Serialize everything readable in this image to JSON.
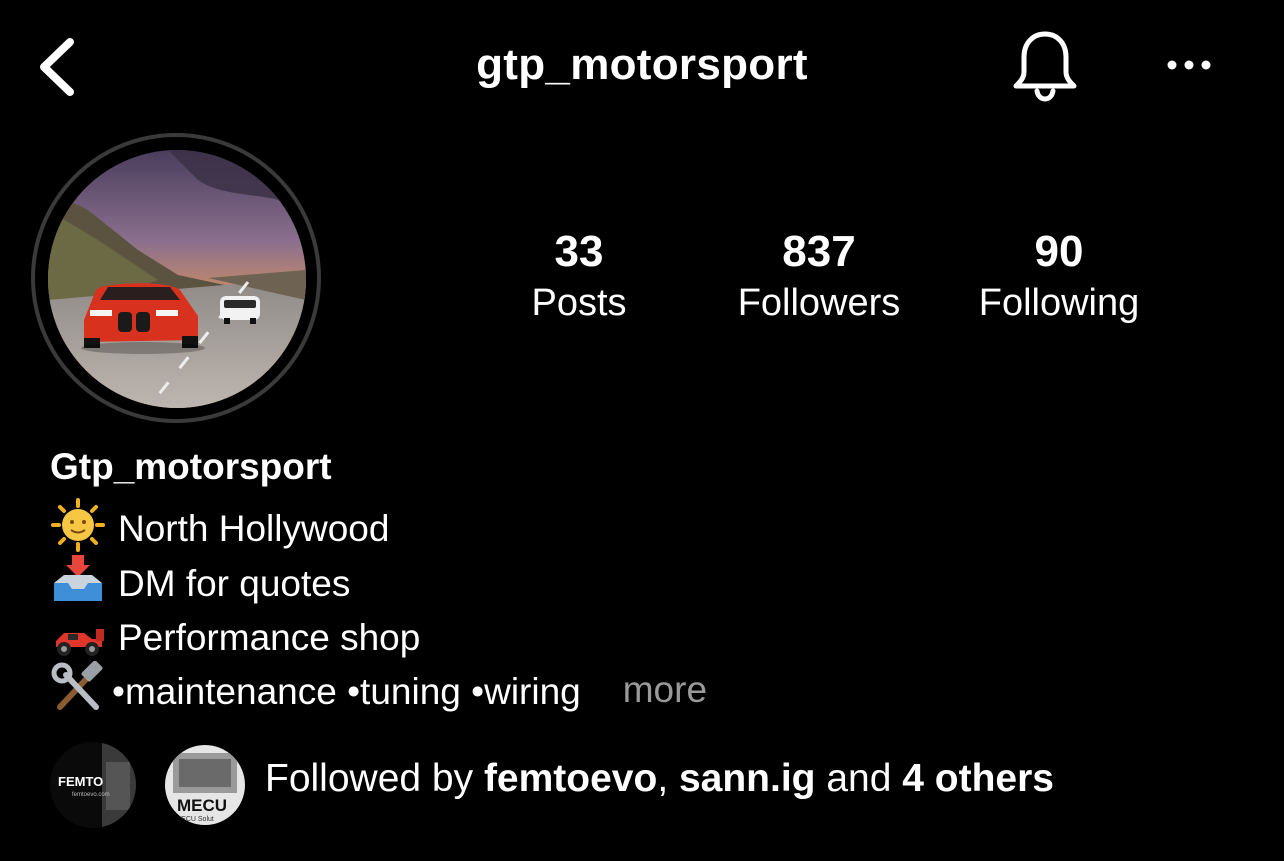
{
  "header": {
    "title": "gtp_motorsport",
    "back_icon": "chevron-left-icon",
    "bell_icon": "bell-icon",
    "more_icon": "more-horizontal-icon"
  },
  "stats": {
    "posts": {
      "count": "33",
      "label": "Posts"
    },
    "followers": {
      "count": "837",
      "label": "Followers"
    },
    "following": {
      "count": "90",
      "label": "Following"
    }
  },
  "bio": {
    "name": "Gtp_motorsport",
    "lines": [
      {
        "emoji": "sun-with-face-icon",
        "text": "North Hollywood"
      },
      {
        "emoji": "inbox-tray-icon",
        "text": "DM for quotes"
      },
      {
        "emoji": "racing-car-icon",
        "text": "Performance shop"
      },
      {
        "emoji": "hammer-and-wrench-icon",
        "text": "•maintenance •tuning •wiring"
      }
    ],
    "more_label": "more"
  },
  "followed_by": {
    "prefix": "Followed by ",
    "user1": "femtoevo",
    "separator": ", ",
    "user2": "sann.ig",
    "middle": " and ",
    "others": "4 others",
    "avatar1_text": "FEMTO",
    "avatar1_sub": "femtoevo.com",
    "avatar2_text": "MECU",
    "avatar2_sub": "er ECU Solut"
  },
  "colors": {
    "background": "#000000",
    "text": "#ffffff",
    "muted": "#9a9a9a",
    "car": "#d8321e"
  }
}
